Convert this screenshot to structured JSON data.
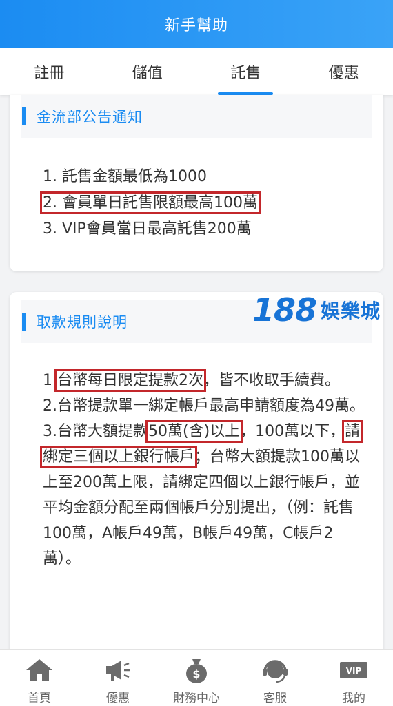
{
  "header": {
    "title": "新手幫助"
  },
  "tabs": [
    {
      "label": "註冊"
    },
    {
      "label": "儲值"
    },
    {
      "label": "託售",
      "active": true
    },
    {
      "label": "優惠"
    }
  ],
  "section1": {
    "title": "金流部公告通知",
    "items": [
      {
        "text": "1. 託售金額最低為1000"
      },
      {
        "text": "2. 會員單日託售限額最高100萬"
      },
      {
        "text": "3. VIP會員當日最高託售200萬"
      }
    ]
  },
  "section2": {
    "title": "取款規則說明",
    "logo": {
      "number": "188",
      "brand": "娛樂城"
    },
    "p1": {
      "a": "1.",
      "b": "台幣每日限定提款2次",
      "c": "，皆不收取手續費。"
    },
    "p2": {
      "text": "2.台幣提款單一綁定帳戶最高申請額度為49萬。"
    },
    "p3": {
      "a": "3.台幣大額提款",
      "b": "50萬(含)以上",
      "c": "，100萬以下，",
      "d": "請綁定三個以上銀行帳戶",
      "e": "；台幣大額提款100萬以上至200萬上限，請綁定四個以上銀行帳戶，並平均金額分配至兩個帳戶分別提出，（例：託售100萬，A帳戶49萬，B帳戶49萬，C帳戶2萬）。"
    }
  },
  "bottom_nav": [
    {
      "label": "首頁",
      "icon": "home-icon"
    },
    {
      "label": "優惠",
      "icon": "megaphone-icon"
    },
    {
      "label": "財務中心",
      "icon": "money-bag-icon"
    },
    {
      "label": "客服",
      "icon": "headset-icon"
    },
    {
      "label": "我的",
      "icon": "vip-card-icon",
      "badge": "VIP"
    }
  ],
  "colors": {
    "primary": "#1b8cf2",
    "highlight_box": "#c3272b",
    "logo": "#1773d6"
  }
}
